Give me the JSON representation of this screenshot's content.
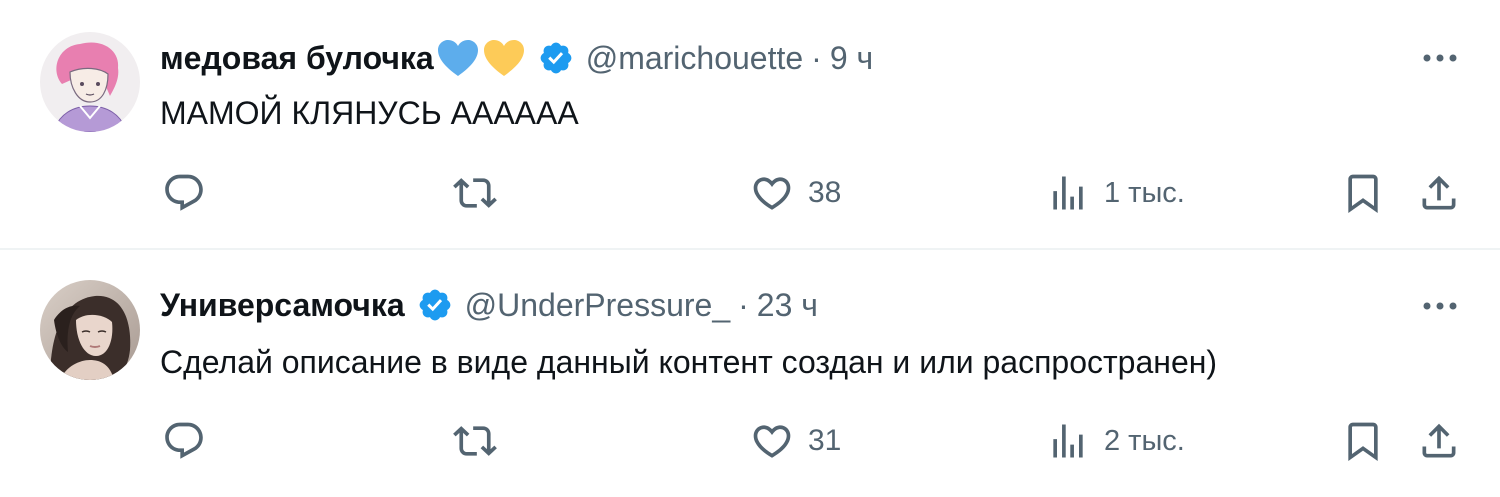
{
  "tweets": [
    {
      "display_name": "медовая булочка",
      "emojis": [
        "blue-heart",
        "yellow-heart"
      ],
      "handle": "@marichouette",
      "separator": "·",
      "time": "9 ч",
      "text": "МАМОЙ КЛЯНУСЬ АААААА",
      "likes": "38",
      "views": "1 тыс."
    },
    {
      "display_name": "Универсамочка",
      "emojis": [],
      "handle": "@UnderPressure_",
      "separator": "·",
      "time": "23 ч",
      "text": "Сделай описание в виде данный контент создан и или распространен)",
      "likes": "31",
      "views": "2 тыс."
    }
  ],
  "icons": {
    "verified": "verified-badge-icon",
    "more": "more-dots-icon",
    "reply": "reply-icon",
    "retweet": "retweet-icon",
    "like": "heart-icon",
    "views": "views-chart-icon",
    "bookmark": "bookmark-icon",
    "share": "share-icon"
  },
  "colors": {
    "verified": "#1d9bf0",
    "text": "#0f1419",
    "secondary": "#536471",
    "divider": "#eff3f4",
    "blue_heart": "#5dadec",
    "yellow_heart": "#fdcb58"
  }
}
